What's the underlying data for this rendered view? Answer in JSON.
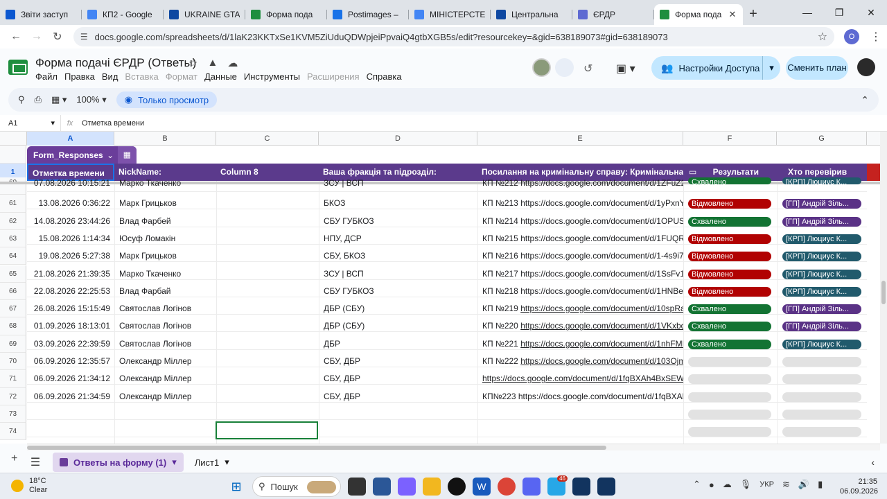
{
  "browser": {
    "tabs": [
      {
        "title": "Звіти заступ",
        "color": "#0b57d0",
        "icon": "generic-app-icon"
      },
      {
        "title": "КП2 - Google",
        "color": "#4285f4",
        "icon": "google-docs-icon"
      },
      {
        "title": "UKRAINE GTA",
        "color": "#0d47a1",
        "icon": "generic-app-icon"
      },
      {
        "title": "Форма пода",
        "color": "#1e8e3e",
        "icon": "google-sheets-icon"
      },
      {
        "title": "Postimages –",
        "color": "#1a73e8",
        "icon": "postimages-icon"
      },
      {
        "title": "МІНІСТЕРСТЕ",
        "color": "#4285f4",
        "icon": "google-docs-icon"
      },
      {
        "title": "Центральна",
        "color": "#0d47a1",
        "icon": "generic-app-icon"
      },
      {
        "title": "ЄРДР",
        "color": "#5e6ad2",
        "icon": "discord-icon"
      },
      {
        "title": "Форма пода",
        "color": "#1e8e3e",
        "icon": "google-sheets-icon",
        "active": true
      }
    ],
    "url": "docs.google.com/spreadsheets/d/1laK23KKTxSe1KVM5ZiUduQDWpjeiPpvaiQ4gtbXGB5s/edit?resourcekey=&gid=638189073#gid=638189073",
    "profile_initial": "O"
  },
  "doc": {
    "title": "Форма подачі ЄРДР (Ответы)",
    "menu": [
      {
        "label": "Файл",
        "enabled": true
      },
      {
        "label": "Правка",
        "enabled": true
      },
      {
        "label": "Вид",
        "enabled": true
      },
      {
        "label": "Вставка",
        "enabled": false
      },
      {
        "label": "Формат",
        "enabled": false
      },
      {
        "label": "Данные",
        "enabled": true
      },
      {
        "label": "Инструменты",
        "enabled": true
      },
      {
        "label": "Расширения",
        "enabled": false
      },
      {
        "label": "Справка",
        "enabled": true
      }
    ],
    "share_label": "Настройки Доступа",
    "plan_label": "Сменить план"
  },
  "toolbar": {
    "zoom": "100%",
    "view_only_label": "Только просмотр"
  },
  "formula": {
    "cell_ref": "A1",
    "fx": "fx",
    "value": "Отметка времени"
  },
  "grid": {
    "columns": [
      "A",
      "B",
      "C",
      "D",
      "E",
      "F",
      "G"
    ],
    "table_name": "Form_Responses",
    "headers": [
      "Отметка времени",
      "NickName:",
      "Column 8",
      "Ваша фракція та підрозділ:",
      "Посилання на кримінальну справу: Кримінальна сп",
      "Результати",
      "Хто перевірив"
    ],
    "header_row_number": "1",
    "rows": [
      {
        "n": "60",
        "time": "07.08.2026 10:15:21",
        "nick": "Марко Ткаченко",
        "faction": "ЗСУ | ВСП",
        "case_prefix": "КП №212",
        "case_link": "https://docs.google.com/document/d/1ZFuZ2Z2",
        "linked": false,
        "result": "Схвалено",
        "reviewer": "[КРП] Люциус К..."
      },
      {
        "n": "61",
        "time": "13.08.2026 0:36:22",
        "nick": "Марк Грицьков",
        "faction": "БКОЗ",
        "case_prefix": "КП №213",
        "case_link": "https://docs.google.com/document/d/1yPxnYQ0",
        "linked": false,
        "result": "Відмовлено",
        "reviewer": "[ГП] Андрій Зіль..."
      },
      {
        "n": "62",
        "time": "14.08.2026 23:44:26",
        "nick": "Влад Фарбей",
        "faction": "СБУ ГУБКОЗ",
        "case_prefix": "КП №214",
        "case_link": "https://docs.google.com/document/d/1OPUSjyF",
        "linked": false,
        "result": "Схвалено",
        "reviewer": "[ГП] Андрій Зіль..."
      },
      {
        "n": "63",
        "time": "15.08.2026 1:14:34",
        "nick": "Юсуф Ломакін",
        "faction": "НПУ, ДСР",
        "case_prefix": "КП №215",
        "case_link": "https://docs.google.com/document/d/1FUQRoj6",
        "linked": false,
        "result": "Відмовлено",
        "reviewer": "[КРП] Люциус К..."
      },
      {
        "n": "64",
        "time": "19.08.2026 5:27:38",
        "nick": "Марк Грицьков",
        "faction": "СБУ, БКОЗ",
        "case_prefix": "КП №216",
        "case_link": "https://docs.google.com/document/d/1-4s9i77X",
        "linked": false,
        "result": "Відмовлено",
        "reviewer": "[КРП] Люциус К..."
      },
      {
        "n": "65",
        "time": "21.08.2026 21:39:35",
        "nick": "Марко Ткаченко",
        "faction": "ЗСУ | ВСП",
        "case_prefix": "КП №217",
        "case_link": "https://docs.google.com/document/d/1SsFv1LS",
        "linked": false,
        "result": "Відмовлено",
        "reviewer": "[КРП] Люциус К..."
      },
      {
        "n": "66",
        "time": "22.08.2026 22:25:53",
        "nick": "Влад Фарбай",
        "faction": "СБУ ГУБКОЗ",
        "case_prefix": "КП №218",
        "case_link": "https://docs.google.com/document/d/1HNBeg9",
        "linked": false,
        "result": "Відмовлено",
        "reviewer": "[КРП] Люциус К..."
      },
      {
        "n": "67",
        "time": "26.08.2026 15:15:49",
        "nick": "Святослав Логінов",
        "faction": "ДБР (СБУ)",
        "case_prefix": "КП №219",
        "case_link": "https://docs.google.com/document/d/10spRa9p",
        "linked": true,
        "result": "Схвалено",
        "reviewer": "[ГП] Андрій Зіль..."
      },
      {
        "n": "68",
        "time": "01.09.2026 18:13:01",
        "nick": "Святослав Логінов",
        "faction": "ДБР (СБУ)",
        "case_prefix": "КП №220",
        "case_link": "https://docs.google.com/document/d/1VKxbdzF",
        "linked": true,
        "result": "Схвалено",
        "reviewer": "[ГП] Андрій Зіль..."
      },
      {
        "n": "69",
        "time": "03.09.2026 22:39:59",
        "nick": "Святослав Логінов",
        "faction": "ДБР",
        "case_prefix": "КП №221",
        "case_link": "https://docs.google.com/document/d/1nhFMRa",
        "linked": true,
        "result": "Схвалено",
        "reviewer": "[КРП] Люциус К..."
      },
      {
        "n": "70",
        "time": "06.09.2026 12:35:57",
        "nick": "Олександр Міллер",
        "faction": "СБУ, ДБР",
        "case_prefix": "КП №222",
        "case_link": "https://docs.google.com/document/d/103Ojmo",
        "linked": true,
        "result": "",
        "reviewer": ""
      },
      {
        "n": "71",
        "time": "06.09.2026 21:34:12",
        "nick": "Олександр Міллер",
        "faction": "СБУ, ДБР",
        "case_prefix": "",
        "case_link": "https://docs.google.com/document/d/1fqBXAh4BxSEWiHI",
        "linked": true,
        "result": "",
        "reviewer": ""
      },
      {
        "n": "72",
        "time": "06.09.2026 21:34:59",
        "nick": "Олександр Міллер",
        "faction": "СБУ, ДБР",
        "case_prefix": "КП№223",
        "case_link": "https://docs.google.com/document/d/1fqBXAh4",
        "linked": false,
        "result": "",
        "reviewer": ""
      },
      {
        "n": "73",
        "time": "",
        "nick": "",
        "faction": "",
        "case_prefix": "",
        "case_link": "",
        "linked": false,
        "result": "",
        "reviewer": ""
      },
      {
        "n": "74",
        "time": "",
        "nick": "",
        "faction": "",
        "case_prefix": "",
        "case_link": "",
        "linked": false,
        "result": "",
        "reviewer": ""
      }
    ],
    "result_colors": {
      "Схвалено": "#137333",
      "Відмовлено": "#b10202"
    },
    "reviewer_colors": {
      "[КРП]": "#215a6c",
      "[ГП]": "#5a3286"
    }
  },
  "sheets": {
    "tabs": [
      {
        "label": "Ответы на форму (1)",
        "active": true
      },
      {
        "label": "Лист1",
        "active": false
      }
    ]
  },
  "taskbar": {
    "temp": "18°C",
    "weather": "Clear",
    "search_label": "Пошук",
    "lang": "УКР",
    "time": "21:35",
    "date": "06.09.2026",
    "telegram_badge": "46"
  }
}
